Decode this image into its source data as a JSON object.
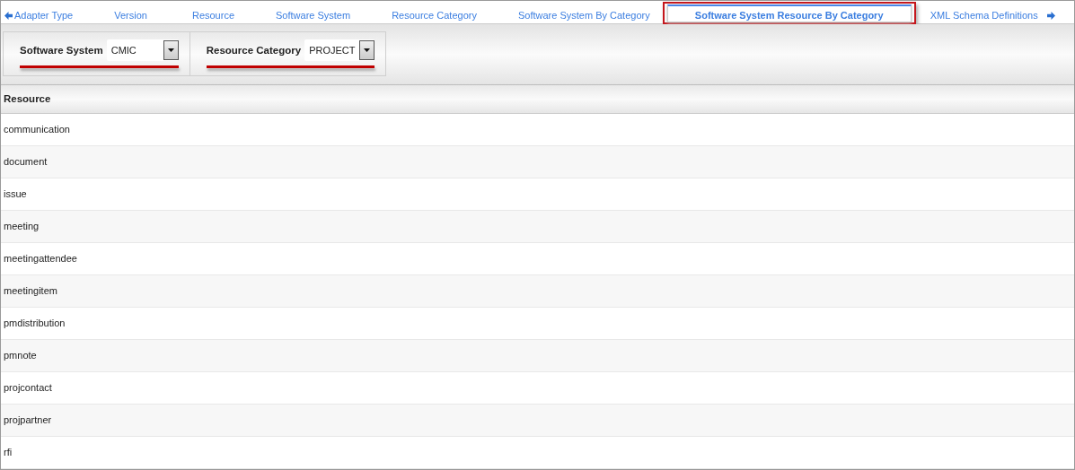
{
  "tabs": [
    {
      "label": "Adapter Type",
      "selected": false
    },
    {
      "label": "Version",
      "selected": false
    },
    {
      "label": "Resource",
      "selected": false
    },
    {
      "label": "Software System",
      "selected": false
    },
    {
      "label": "Resource Category",
      "selected": false
    },
    {
      "label": "Software System By Category",
      "selected": false
    },
    {
      "label": "Software System Resource By Category",
      "selected": true
    },
    {
      "label": "XML Schema Definitions",
      "selected": false
    }
  ],
  "filters": [
    {
      "label": "Software System",
      "value": "CMIC"
    },
    {
      "label": "Resource Category",
      "value": "PROJECT"
    }
  ],
  "table": {
    "columns": [
      "Resource"
    ],
    "rows": [
      "communication",
      "document",
      "issue",
      "meeting",
      "meetingattendee",
      "meetingitem",
      "pmdistribution",
      "pmnote",
      "projcontact",
      "projpartner",
      "rfi"
    ]
  }
}
